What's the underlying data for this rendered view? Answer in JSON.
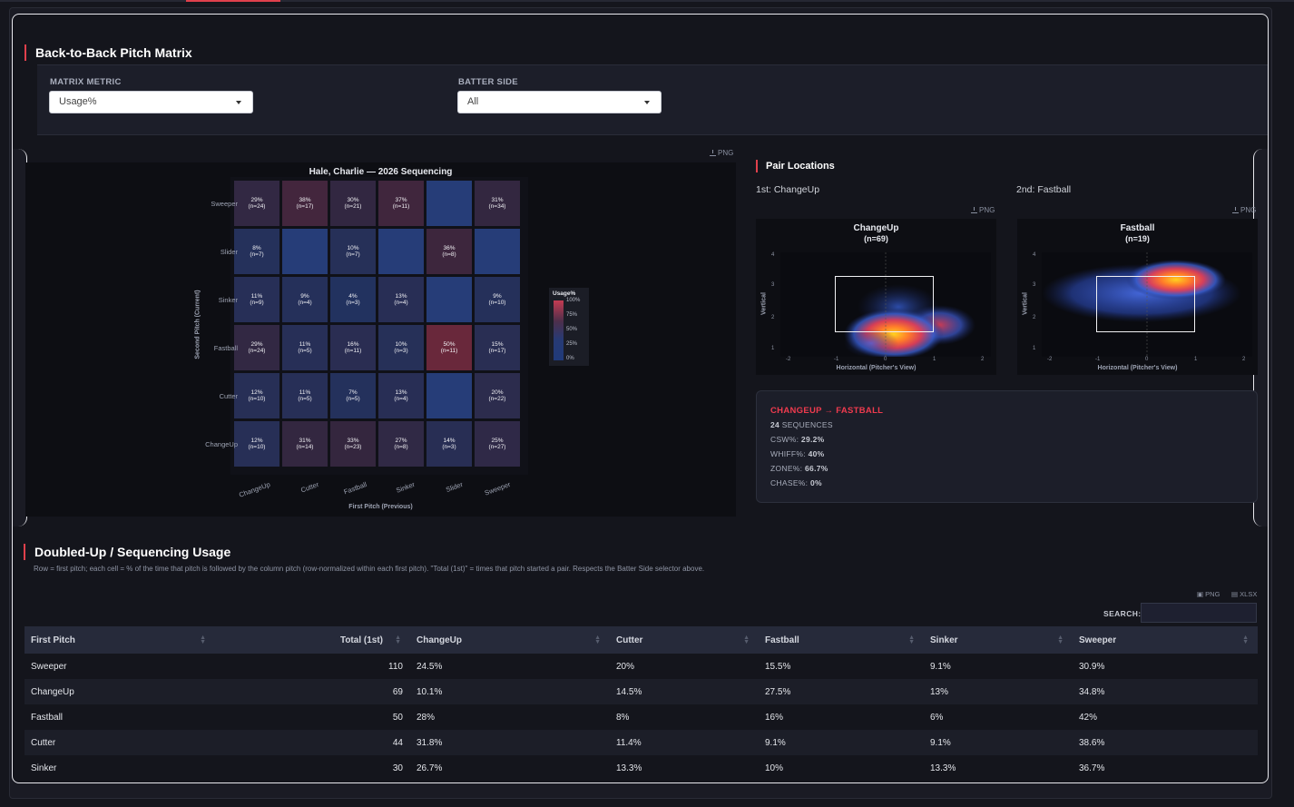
{
  "matrix_section": {
    "title": "Back-to-Back Pitch Matrix",
    "metric_label": "MATRIX METRIC",
    "metric_value": "Usage%",
    "side_label": "BATTER SIDE",
    "side_value": "All"
  },
  "heatmap": {
    "png_label": "PNG",
    "title": "Hale, Charlie — 2026 Sequencing",
    "colorbar_title": "Usage%",
    "colorbar_ticks": [
      "100%",
      "75%",
      "50%",
      "25%",
      "0%"
    ]
  },
  "chart_data": [
    {
      "type": "heatmap",
      "title": "Hale, Charlie — 2026 Sequencing",
      "xlabel": "First Pitch (Previous)",
      "ylabel": "Second Pitch (Current)",
      "x_categories": [
        "ChangeUp",
        "Cutter",
        "Fastball",
        "Sinker",
        "Slider",
        "Sweeper"
      ],
      "y_categories": [
        "Sweeper",
        "Slider",
        "Sinker",
        "Fastball",
        "Cutter",
        "ChangeUp"
      ],
      "cells": [
        [
          {
            "p": 29,
            "n": 24
          },
          {
            "p": 38,
            "n": 17
          },
          {
            "p": 30,
            "n": 21
          },
          {
            "p": 37,
            "n": 11
          },
          null,
          {
            "p": 31,
            "n": 34
          }
        ],
        [
          {
            "p": 8,
            "n": 7
          },
          null,
          {
            "p": 10,
            "n": 7
          },
          null,
          {
            "p": 36,
            "n": 8
          },
          null
        ],
        [
          {
            "p": 11,
            "n": 9
          },
          {
            "p": 9,
            "n": 4
          },
          {
            "p": 4,
            "n": 3
          },
          {
            "p": 13,
            "n": 4
          },
          null,
          {
            "p": 9,
            "n": 10
          }
        ],
        [
          {
            "p": 29,
            "n": 24
          },
          {
            "p": 11,
            "n": 5
          },
          {
            "p": 16,
            "n": 11
          },
          {
            "p": 10,
            "n": 3
          },
          {
            "p": 50,
            "n": 11
          },
          {
            "p": 15,
            "n": 17
          }
        ],
        [
          {
            "p": 12,
            "n": 10
          },
          {
            "p": 11,
            "n": 5
          },
          {
            "p": 7,
            "n": 5
          },
          {
            "p": 13,
            "n": 4
          },
          null,
          {
            "p": 20,
            "n": 22
          }
        ],
        [
          {
            "p": 12,
            "n": 10
          },
          {
            "p": 31,
            "n": 14
          },
          {
            "p": 33,
            "n": 23
          },
          {
            "p": 27,
            "n": 8
          },
          {
            "p": 14,
            "n": 3
          },
          {
            "p": 25,
            "n": 27
          }
        ]
      ],
      "colorbar_range": [
        0,
        100
      ]
    },
    {
      "type": "heatmap",
      "title": "ChangeUp",
      "subtitle": "(n=69)",
      "xlabel": "Horizontal (Pitcher's View)",
      "ylabel": "Vertical",
      "xlim": [
        -2.3,
        2.3
      ],
      "ylim": [
        0.8,
        4.2
      ],
      "x_ticks": [
        "-2",
        "-1",
        "0",
        "1",
        "2"
      ],
      "y_ticks": [
        "4",
        "3",
        "2",
        "1"
      ]
    },
    {
      "type": "heatmap",
      "title": "Fastball",
      "subtitle": "(n=19)",
      "xlabel": "Horizontal (Pitcher's View)",
      "ylabel": "Vertical",
      "xlim": [
        -2.3,
        2.3
      ],
      "ylim": [
        0.8,
        4.2
      ],
      "x_ticks": [
        "-2",
        "-1",
        "0",
        "1",
        "2"
      ],
      "y_ticks": [
        "4",
        "3",
        "2",
        "1"
      ]
    }
  ],
  "pair": {
    "title": "Pair Locations",
    "first_label": "1st: ChangeUp",
    "second_label": "2nd: Fastball",
    "png_label": "PNG",
    "plot1": {
      "title": "ChangeUp",
      "count": "(n=69)"
    },
    "plot2": {
      "title": "Fastball",
      "count": "(n=19)"
    },
    "xlabel": "Horizontal (Pitcher's View)",
    "ylabel": "Vertical",
    "x_ticks": [
      "-2",
      "-1",
      "0",
      "1",
      "2"
    ],
    "y_ticks": [
      "4",
      "3",
      "2",
      "1"
    ]
  },
  "stats": {
    "header": "CHANGEUP → FASTBALL",
    "sequences_value": "24",
    "sequences_label": "SEQUENCES",
    "csw_label": "CSW%:",
    "csw_value": "29.2%",
    "whiff_label": "WHIFF%:",
    "whiff_value": "40%",
    "zone_label": "ZONE%:",
    "zone_value": "66.7%",
    "chase_label": "CHASE%:",
    "chase_value": "0%"
  },
  "usage_section": {
    "title": "Doubled-Up / Sequencing Usage",
    "description": "Row = first pitch; each cell = % of the time that pitch is followed by the column pitch (row-normalized within each first pitch). \"Total (1st)\" = times that pitch started a pair. Respects the Batter Side selector above.",
    "png_label": "PNG",
    "xlsx_label": "XLSX",
    "search_label": "SEARCH:",
    "columns": [
      "First Pitch",
      "Total (1st)",
      "ChangeUp",
      "Cutter",
      "Fastball",
      "Sinker",
      "Sweeper"
    ],
    "rows": [
      [
        "Sweeper",
        "110",
        "24.5%",
        "20%",
        "15.5%",
        "9.1%",
        "30.9%"
      ],
      [
        "ChangeUp",
        "69",
        "10.1%",
        "14.5%",
        "27.5%",
        "13%",
        "34.8%"
      ],
      [
        "Fastball",
        "50",
        "28%",
        "8%",
        "16%",
        "6%",
        "42%"
      ],
      [
        "Cutter",
        "44",
        "31.8%",
        "11.4%",
        "9.1%",
        "9.1%",
        "38.6%"
      ],
      [
        "Sinker",
        "30",
        "26.7%",
        "13.3%",
        "10%",
        "13.3%",
        "36.7%"
      ]
    ]
  }
}
